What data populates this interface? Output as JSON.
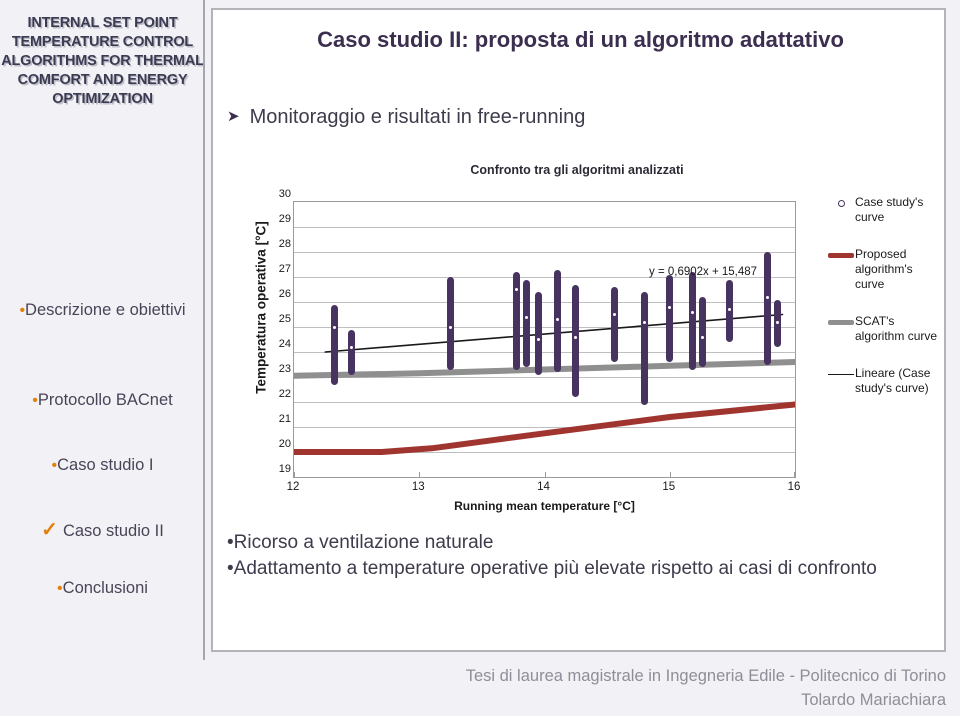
{
  "sidebar": {
    "title": "INTERNAL SET POINT TEMPERATURE CONTROL ALGORITHMS FOR THERMAL COMFORT AND ENERGY OPTIMIZATION",
    "items": [
      {
        "label": "Descrizione e obiettivi",
        "marker": "bullet",
        "active": false
      },
      {
        "label": "Protocollo BACnet",
        "marker": "bullet",
        "active": false
      },
      {
        "label": "Caso studio I",
        "marker": "bullet",
        "active": false
      },
      {
        "label": "Caso studio II",
        "marker": "check",
        "active": true
      },
      {
        "label": "Conclusioni",
        "marker": "bullet",
        "active": false
      }
    ],
    "marker_color": "#E1810B"
  },
  "slide": {
    "title": "Caso studio II: proposta di un algoritmo adattativo",
    "subhead_arrow": "➤",
    "subhead": "Monitoraggio e risultati in free-running",
    "bullets": [
      "•Ricorso a ventilazione naturale",
      "•Adattamento a temperature operative più elevate rispetto ai casi di confronto"
    ]
  },
  "footer": {
    "line1": "Tesi di laurea magistrale in Ingegneria Edile - Politecnico di Torino",
    "line2": "Tolardo Mariachiara"
  },
  "chart_data": {
    "type": "scatter",
    "title": "Confronto tra gli algoritmi analizzati",
    "xlabel": "Running mean temperature [°C]",
    "ylabel": "Temperatura operativa [°C]",
    "xlim": [
      12,
      16
    ],
    "ylim": [
      19,
      30
    ],
    "xticks": [
      12,
      13,
      14,
      15,
      16
    ],
    "yticks": [
      19,
      20,
      21,
      22,
      23,
      24,
      25,
      26,
      27,
      28,
      29,
      30
    ],
    "grid": true,
    "annotation": "y = 0,6902x + 15,487",
    "legend_position": "right",
    "colors": {
      "scatter": "#473360",
      "proposed": "#A03530",
      "scat": "#8F8F8F",
      "trend": "#1A1A1A"
    },
    "series": [
      {
        "name": "Case study's curve",
        "type": "scatter",
        "color": "#473360",
        "clusters": [
          {
            "x": 12.32,
            "y_min": 22.7,
            "y_max": 25.9,
            "y_mean": 25.0
          },
          {
            "x": 12.46,
            "y_min": 23.1,
            "y_max": 24.9,
            "y_mean": 24.2
          },
          {
            "x": 13.25,
            "y_min": 23.3,
            "y_max": 27.0,
            "y_mean": 25.0
          },
          {
            "x": 13.78,
            "y_min": 23.3,
            "y_max": 27.2,
            "y_mean": 26.5
          },
          {
            "x": 13.86,
            "y_min": 23.4,
            "y_max": 26.9,
            "y_mean": 25.4
          },
          {
            "x": 13.95,
            "y_min": 23.1,
            "y_max": 26.4,
            "y_mean": 24.5
          },
          {
            "x": 14.1,
            "y_min": 23.2,
            "y_max": 27.3,
            "y_mean": 25.3
          },
          {
            "x": 14.25,
            "y_min": 22.2,
            "y_max": 26.7,
            "y_mean": 24.6
          },
          {
            "x": 14.56,
            "y_min": 23.6,
            "y_max": 26.6,
            "y_mean": 25.5
          },
          {
            "x": 14.8,
            "y_min": 21.9,
            "y_max": 26.4,
            "y_mean": 25.2
          },
          {
            "x": 15.0,
            "y_min": 23.6,
            "y_max": 27.1,
            "y_mean": 25.8
          },
          {
            "x": 15.18,
            "y_min": 23.3,
            "y_max": 27.2,
            "y_mean": 25.6
          },
          {
            "x": 15.26,
            "y_min": 23.4,
            "y_max": 26.2,
            "y_mean": 24.6
          },
          {
            "x": 15.48,
            "y_min": 24.4,
            "y_max": 26.9,
            "y_mean": 25.7
          },
          {
            "x": 15.78,
            "y_min": 23.5,
            "y_max": 28.0,
            "y_mean": 26.2
          },
          {
            "x": 15.86,
            "y_min": 24.2,
            "y_max": 26.1,
            "y_mean": 25.2
          }
        ]
      },
      {
        "name": "Proposed algorithm's curve",
        "type": "line",
        "color": "#A03530",
        "points": [
          [
            12,
            20.0
          ],
          [
            12.7,
            20.0
          ],
          [
            13.1,
            20.15
          ],
          [
            14,
            20.75
          ],
          [
            15,
            21.4
          ],
          [
            16,
            21.9
          ]
        ]
      },
      {
        "name": "SCAT's algorithm curve",
        "type": "line",
        "color": "#8F8F8F",
        "points": [
          [
            12,
            23.05
          ],
          [
            13,
            23.15
          ],
          [
            14,
            23.3
          ],
          [
            15,
            23.45
          ],
          [
            16,
            23.6
          ]
        ]
      },
      {
        "name": "Lineare (Case study's curve)",
        "type": "trendline",
        "color": "#1A1A1A",
        "points": [
          [
            12.25,
            24.0
          ],
          [
            15.9,
            25.5
          ]
        ],
        "equation": "y = 0,6902x + 15,487"
      }
    ],
    "legend": [
      {
        "label": "Case study's curve",
        "key": "marker"
      },
      {
        "label": "Proposed algorithm's curve",
        "key": "line-red"
      },
      {
        "label": "SCAT's algorithm curve",
        "key": "line-gray"
      },
      {
        "label": "Lineare (Case study's curve)",
        "key": "line-thin"
      }
    ]
  }
}
